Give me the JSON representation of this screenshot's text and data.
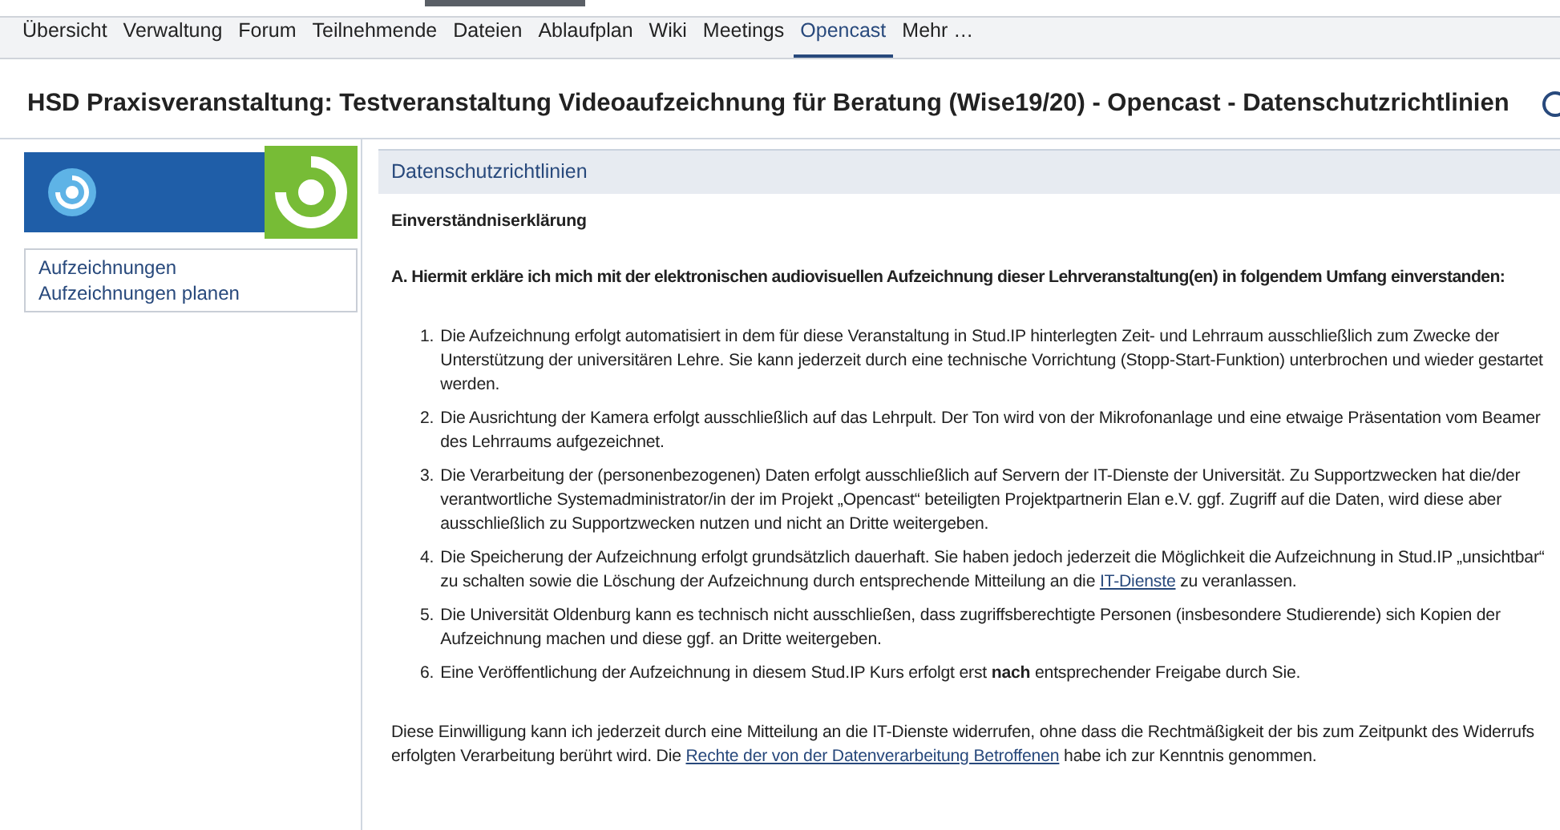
{
  "nav": [
    {
      "label": "Übersicht",
      "selected": false
    },
    {
      "label": "Verwaltung",
      "selected": false
    },
    {
      "label": "Forum",
      "selected": false
    },
    {
      "label": "Teilnehmende",
      "selected": false
    },
    {
      "label": "Dateien",
      "selected": false
    },
    {
      "label": "Ablaufplan",
      "selected": false
    },
    {
      "label": "Wiki",
      "selected": false
    },
    {
      "label": "Meetings",
      "selected": false
    },
    {
      "label": "Opencast",
      "selected": true
    },
    {
      "label": "Mehr …",
      "selected": false
    }
  ],
  "page_title": "HSD Praxisveranstaltung: Testveranstaltung Videoaufzeichnung für Beratung (Wise19/20) - Opencast - Datenschutzrichtlinien",
  "sidebar": {
    "items": [
      {
        "label": "Aufzeichnungen",
        "selected": false
      },
      {
        "label": "Aufzeichnungen planen",
        "selected": false
      }
    ]
  },
  "content": {
    "heading": "Datenschutzrichtlinien",
    "subheading": "Einverständniserklärung",
    "intro": "A. Hiermit erkläre ich mich mit der elektronischen audiovisuellen Aufzeichnung dieser Lehrveranstaltung(en) in folgendem Umfang einverstanden:",
    "items": [
      {
        "number": "1.",
        "text": "Die Aufzeichnung erfolgt automatisiert in dem für diese Veranstaltung in Stud.IP hinterlegten Zeit- und Lehrraum ausschließlich zum Zwecke der Unterstützung der universitären Lehre. Sie kann jederzeit durch eine technische Vorrichtung (Stopp-Start-Funktion) unterbrochen und wieder gestartet werden."
      },
      {
        "number": "2.",
        "text": "Die Ausrichtung der Kamera erfolgt ausschließlich auf das Lehrpult. Der Ton wird von der Mikrofonanlage und eine etwaige Präsentation vom Beamer des Lehrraums aufgezeichnet."
      },
      {
        "number": "3.",
        "text": "Die Verarbeitung der (personenbezogenen) Daten erfolgt ausschließlich auf Servern der IT-Dienste der Universität. Zu Supportzwecken hat die/der verantwortliche Systemadministrator/in der im Projekt „Opencast“ beteiligten Projektpartnerin Elan e.V. ggf. Zugriff auf die Daten, wird diese aber ausschließlich zu Supportzwecken nutzen und nicht an Dritte weitergeben."
      },
      {
        "number": "4.",
        "text": "Die Speicherung der Aufzeichnung erfolgt grundsätzlich dauerhaft. Sie haben jedoch jederzeit die Möglichkeit die Aufzeichnung in Stud.IP „unsichtbar“ zu schalten sowie die Löschung der Aufzeichnung durch entsprechende Mitteilung an die",
        "link": "IT-Dienste",
        "text_after": "zu veranlassen."
      },
      {
        "number": "5.",
        "text": "Die Universität Oldenburg kann es technisch nicht ausschließen, dass zugriffsberechtigte Personen (insbesondere Studierende) sich Kopien der Aufzeichnung machen und diese ggf. an Dritte weitergeben."
      },
      {
        "number": "6.",
        "text": "Eine Veröffentlichung der Aufzeichnung in diesem Stud.IP Kurs erfolgt erst **nach** entsprechender Freigabe durch Sie."
      }
    ],
    "footer": {
      "text": "Diese Einwilligung kann ich jederzeit durch eine Mitteilung an die IT-Dienste widerrufen, ohne dass die Rechtmäßigkeit der bis zum Zeitpunkt des Widerrufs erfolgten Verarbeitung berührt wird. Die",
      "link": "Rechte der von der Datenverarbeitung Betroffenen",
      "text_after": "habe ich zur Kenntnis genommen."
    }
  }
}
